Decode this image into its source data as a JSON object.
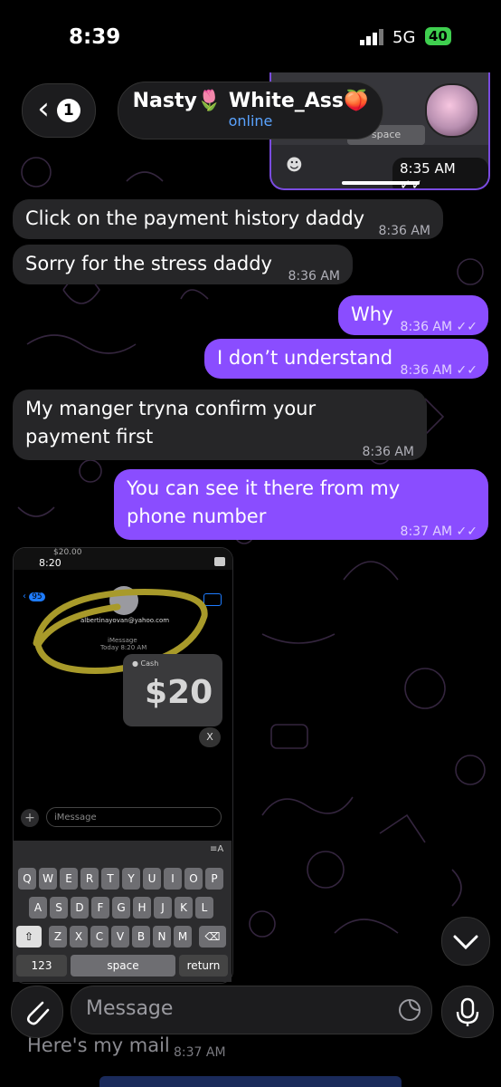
{
  "status_bar": {
    "time": "8:39",
    "network": "5G",
    "battery": "40"
  },
  "header": {
    "back_count": "1",
    "chat_name": "Nasty🌷 White_Ass🍑",
    "presence": "online"
  },
  "top_fragment": {
    "space_label": "space",
    "time": "8:35 AM"
  },
  "messages": [
    {
      "dir": "in",
      "text": "Click on the payment history daddy",
      "time": "8:36 AM"
    },
    {
      "dir": "in",
      "text": "Sorry for the stress daddy",
      "time": "8:36 AM"
    },
    {
      "dir": "out",
      "text": "Why",
      "time": "8:36 AM"
    },
    {
      "dir": "out",
      "text": "I don’t understand",
      "time": "8:36 AM"
    },
    {
      "dir": "in",
      "text": "My manger tryna confirm your payment first",
      "time": "8:36 AM"
    },
    {
      "dir": "out",
      "text": "You can see it there from my phone number",
      "time": "8:37 AM"
    }
  ],
  "embedded_screenshot": {
    "top_amount": "$20.00",
    "time": "8:20",
    "back_badge": "95",
    "email": "albertinayovan@yahoo.com",
    "imessage_label": "iMessage",
    "timestamp": "Today 8:20 AM",
    "cash_label": "Cash",
    "amount": "$20",
    "x_label": "X",
    "input_placeholder": "iMessage",
    "row1": [
      "Q",
      "W",
      "E",
      "R",
      "T",
      "Y",
      "U",
      "I",
      "O",
      "P"
    ],
    "row2": [
      "A",
      "S",
      "D",
      "F",
      "G",
      "H",
      "J",
      "K",
      "L"
    ],
    "row3": [
      "Z",
      "X",
      "C",
      "V",
      "B",
      "N",
      "M"
    ],
    "key_123": "123",
    "key_space": "space",
    "key_return": "return",
    "key_format": "≡A"
  },
  "composer": {
    "placeholder": "Message"
  },
  "below_fold": {
    "text": "Here's my mail",
    "time": "8:37 AM"
  },
  "colors": {
    "outgoing": "#8a4dff",
    "incoming": "#262628",
    "link": "#5aa3ff"
  }
}
